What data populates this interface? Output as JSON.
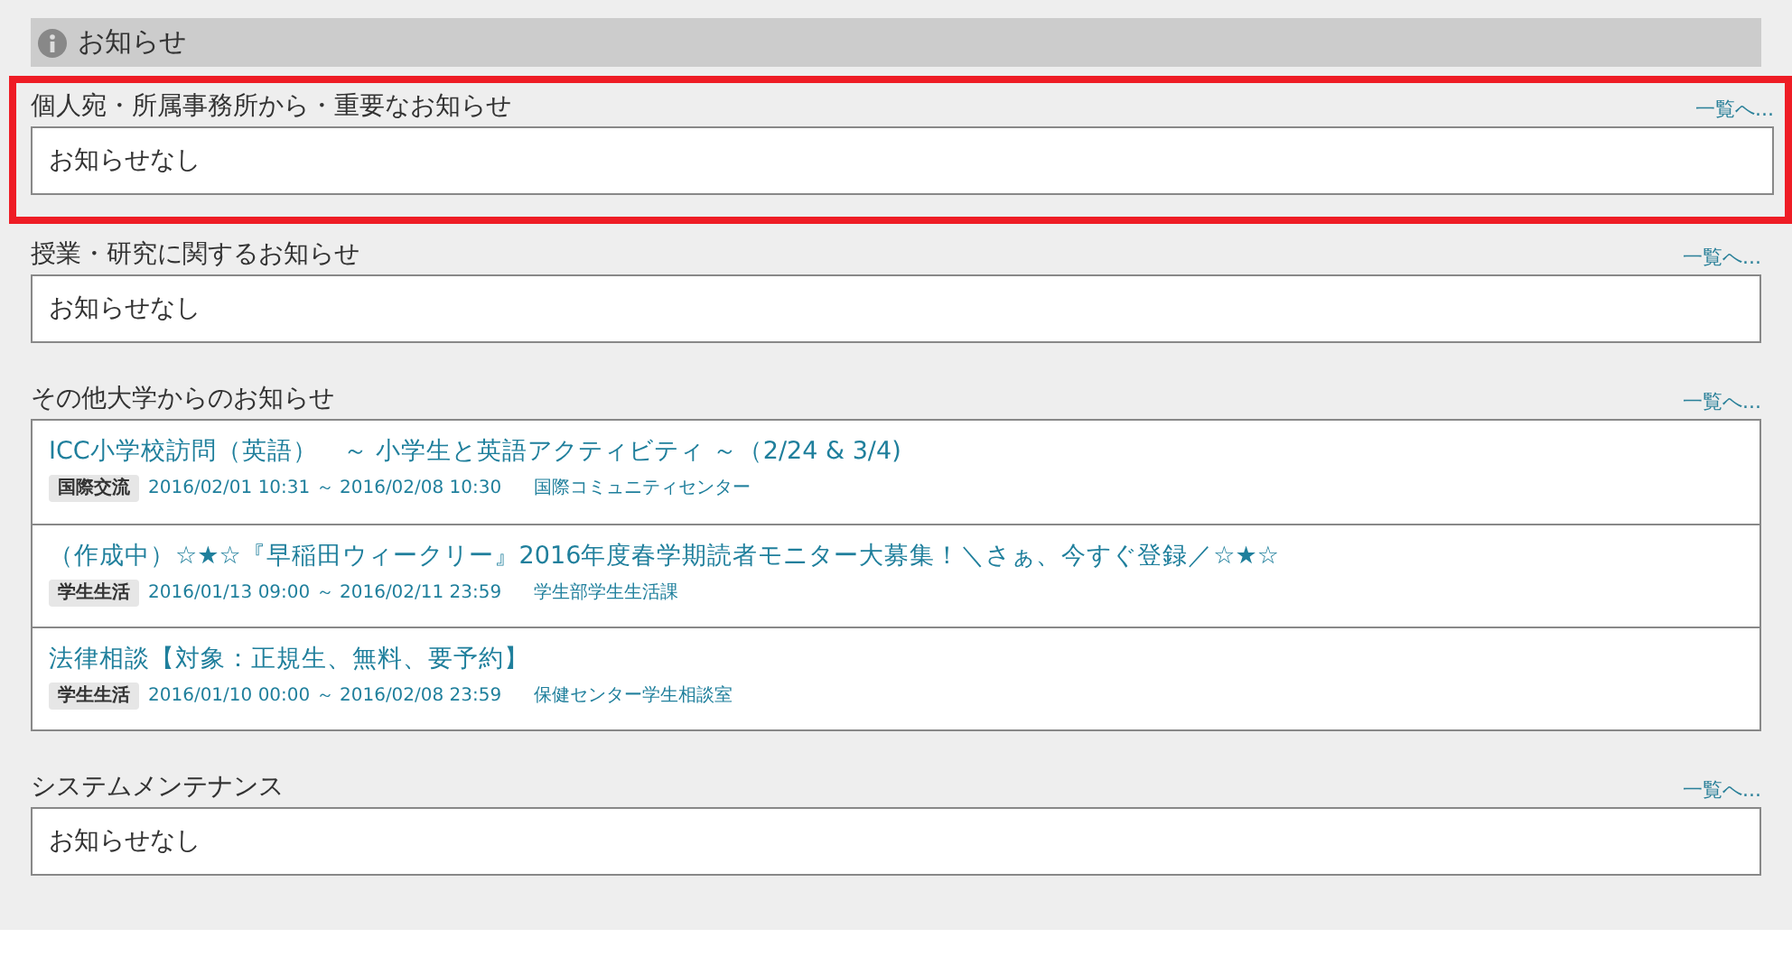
{
  "header": {
    "title": "お知らせ"
  },
  "sections": [
    {
      "title": "個人宛・所属事務所から・重要なお知らせ",
      "link": "一覧へ...",
      "highlighted": true,
      "kind": "empty",
      "message": "お知らせなし"
    },
    {
      "title": "授業・研究に関するお知らせ",
      "link": "一覧へ...",
      "highlighted": false,
      "kind": "empty",
      "message": "お知らせなし"
    },
    {
      "title": "その他大学からのお知らせ",
      "link": "一覧へ...",
      "highlighted": false,
      "kind": "list",
      "items": [
        {
          "title": "ICC小学校訪問（英語）　～ 小学生と英語アクティビティ ～（2/24 & 3/4)",
          "tag": "国際交流",
          "period": "2016/02/01 10:31 ～ 2016/02/08 10:30",
          "source": "国際コミュニティセンター"
        },
        {
          "title": "（作成中）☆★☆『早稲田ウィークリー』2016年度春学期読者モニター大募集！＼さぁ、今すぐ登録／☆★☆",
          "tag": "学生生活",
          "period": "2016/01/13 09:00 ～ 2016/02/11 23:59",
          "source": "学生部学生生活課"
        },
        {
          "title": "法律相談【対象：正規生、無料、要予約】",
          "tag": "学生生活",
          "period": "2016/01/10 00:00 ～ 2016/02/08 23:59",
          "source": "保健センター学生相談室"
        }
      ]
    },
    {
      "title": "システムメンテナンス",
      "link": "一覧へ...",
      "highlighted": false,
      "kind": "empty",
      "message": "お知らせなし"
    }
  ]
}
